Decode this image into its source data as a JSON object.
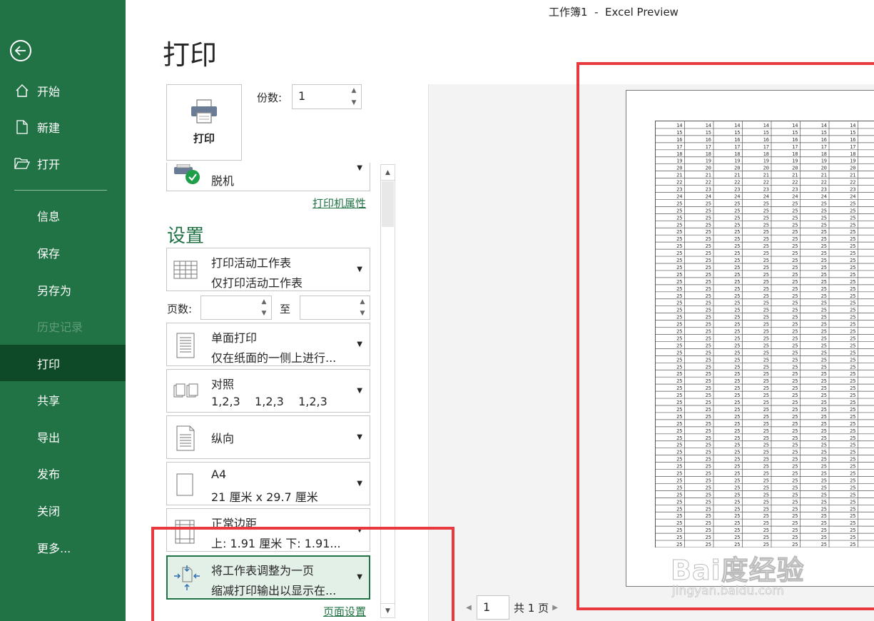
{
  "window": {
    "title": "工作簿1  -  Excel Preview"
  },
  "sidebar": {
    "items": [
      {
        "label": "开始",
        "icon": "home-icon"
      },
      {
        "label": "新建",
        "icon": "new-document-icon"
      },
      {
        "label": "打开",
        "icon": "open-folder-icon"
      },
      {
        "label": "信息"
      },
      {
        "label": "保存"
      },
      {
        "label": "另存为"
      },
      {
        "label": "历史记录",
        "disabled": true
      },
      {
        "label": "打印",
        "active": true
      },
      {
        "label": "共享"
      },
      {
        "label": "导出"
      },
      {
        "label": "发布"
      },
      {
        "label": "关闭"
      },
      {
        "label": "更多..."
      }
    ]
  },
  "print": {
    "heading": "打印",
    "button_label": "打印",
    "copies_label": "份数:",
    "copies_value": "1",
    "printer_name": "脱机",
    "printer_properties_link": "打印机属性",
    "settings_heading": "设置",
    "what_to_print": {
      "title": "打印活动工作表",
      "subtitle": "仅打印活动工作表"
    },
    "pages_label": "页数:",
    "pages_to_label": "至",
    "sides": {
      "title": "单面打印",
      "subtitle": "仅在纸面的一侧上进行..."
    },
    "collation": {
      "title": "对照",
      "subtitle": "1,2,3    1,2,3    1,2,3"
    },
    "orientation": {
      "title": "纵向"
    },
    "paper_size": {
      "title": "A4",
      "subtitle": "21 厘米 x 29.7 厘米"
    },
    "margins": {
      "title": "正常边距",
      "subtitle": "上: 1.91 厘米 下: 1.91..."
    },
    "scaling": {
      "title": "将工作表调整为一页",
      "subtitle": "缩减打印输出以显示在..."
    },
    "page_setup_link": "页面设置"
  },
  "preview": {
    "page_number": "1",
    "page_total": "共 1 页",
    "rows": [
      "14",
      "15",
      "16",
      "17",
      "18",
      "19",
      "20",
      "21",
      "22",
      "23",
      "24",
      "25",
      "25",
      "25",
      "25",
      "25",
      "25",
      "25",
      "25",
      "25",
      "25",
      "25",
      "25",
      "25",
      "25",
      "25",
      "25",
      "25",
      "25",
      "25",
      "25",
      "25",
      "25",
      "25",
      "25",
      "25",
      "25",
      "25",
      "25",
      "25",
      "25",
      "25",
      "25",
      "25",
      "25",
      "25",
      "25",
      "25",
      "25",
      "25",
      "25",
      "25",
      "25",
      "25",
      "25",
      "25",
      "25",
      "25",
      "25",
      "25"
    ]
  },
  "watermark": {
    "brand": "Bai度经验",
    "url": "jingyan.baidu.com"
  },
  "colors": {
    "accent": "#217346",
    "sidebar_active": "#0e4a27",
    "annotation": "#e8393f"
  }
}
